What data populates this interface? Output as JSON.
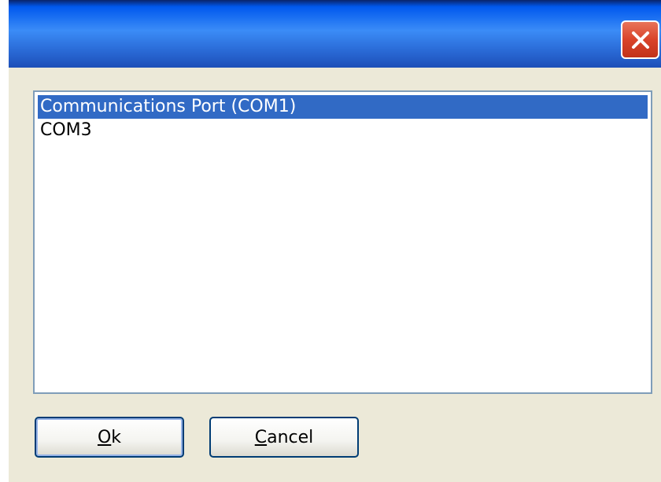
{
  "window": {
    "title": "",
    "colors": {
      "titlebar": "#2a6ad6",
      "close": "#d9432a",
      "background": "#ece9d8",
      "selection": "#316ac5"
    },
    "close_icon": "close-icon"
  },
  "listbox": {
    "items": [
      {
        "label": "Communications Port (COM1)",
        "selected": true
      },
      {
        "label": "COM3",
        "selected": false
      }
    ]
  },
  "buttons": {
    "ok": {
      "mnemonic": "O",
      "rest": "k"
    },
    "cancel": {
      "mnemonic": "C",
      "rest": "ancel"
    }
  }
}
